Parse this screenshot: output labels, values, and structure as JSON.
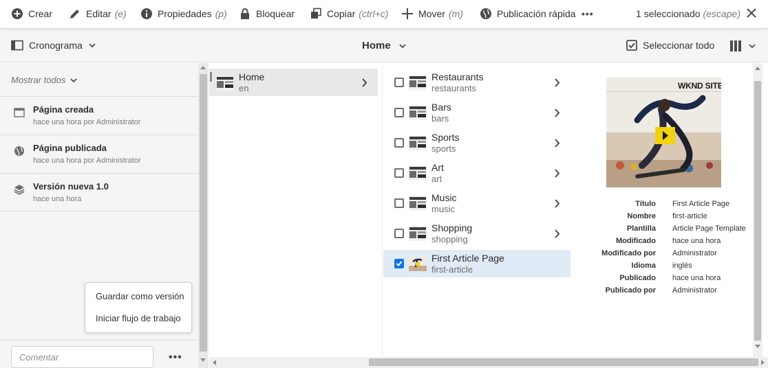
{
  "toolbar": {
    "create": "Crear",
    "edit": "Editar",
    "edit_kbd": "(e)",
    "properties": "Propiedades",
    "properties_kbd": "(p)",
    "lock": "Bloquear",
    "copy": "Copiar",
    "copy_kbd": "(ctrl+c)",
    "move": "Mover",
    "move_kbd": "(m)",
    "quick_publish": "Publicación rápida",
    "more": "•••",
    "selection_count": "1 seleccionado",
    "selection_kbd": "(escape)"
  },
  "subheader": {
    "rail_label": "Cronograma",
    "breadcrumb": "Home",
    "select_all": "Seleccionar todo"
  },
  "rail": {
    "filter": "Mostrar todos",
    "items": [
      {
        "title": "Página creada",
        "subtitle": "hace una hora por Administrator",
        "icon": "page-icon"
      },
      {
        "title": "Página publicada",
        "subtitle": "hace una hora por Administrator",
        "icon": "globe-icon"
      },
      {
        "title": "Versión nueva 1.0",
        "subtitle": "hace una hora",
        "icon": "layers-icon"
      }
    ],
    "popover": {
      "save_version": "Guardar como versión",
      "start_workflow": "Iniciar flujo de trabajo"
    },
    "comment_placeholder": "Comentar",
    "more": "•••"
  },
  "column1": {
    "items": [
      {
        "title": "Home",
        "name": "en"
      }
    ]
  },
  "column2": {
    "items": [
      {
        "title": "Restaurants",
        "name": "restaurants",
        "checked": false,
        "has_children": true
      },
      {
        "title": "Bars",
        "name": "bars",
        "checked": false,
        "has_children": true
      },
      {
        "title": "Sports",
        "name": "sports",
        "checked": false,
        "has_children": true
      },
      {
        "title": "Art",
        "name": "art",
        "checked": false,
        "has_children": true
      },
      {
        "title": "Music",
        "name": "music",
        "checked": false,
        "has_children": true
      },
      {
        "title": "Shopping",
        "name": "shopping",
        "checked": false,
        "has_children": true
      },
      {
        "title": "First Article Page",
        "name": "first-article",
        "checked": true,
        "has_children": false
      }
    ]
  },
  "preview": {
    "brand": "WKND SITE",
    "meta": [
      {
        "label": "Título",
        "value": "First Article Page"
      },
      {
        "label": "Nombre",
        "value": "first-article"
      },
      {
        "label": "Plantilla",
        "value": "Article Page Template"
      },
      {
        "label": "Modificado",
        "value": "hace una hora"
      },
      {
        "label": "Modificado por",
        "value": "Administrator"
      },
      {
        "label": "Idioma",
        "value": "inglés"
      },
      {
        "label": "Publicado",
        "value": "hace una hora"
      },
      {
        "label": "Publicado por",
        "value": "Administrator"
      }
    ]
  },
  "colors": {
    "accent": "#1473e6",
    "selected_row": "#e1ebf7",
    "rail_bg": "#f5f5f5",
    "play_button": "#f2d20d"
  }
}
